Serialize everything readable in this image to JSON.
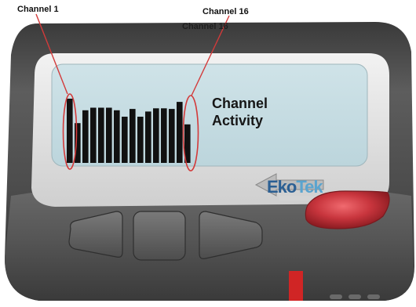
{
  "annotations": {
    "channel_first": "Channel 1",
    "channel_last": "Channel 16",
    "channel_last_ghost": "Channel 16"
  },
  "screen": {
    "caption_line1": "Channel",
    "caption_line2": "Activity",
    "bar_levels": [
      1.0,
      0.62,
      0.82,
      0.86,
      0.86,
      0.86,
      0.82,
      0.72,
      0.84,
      0.72,
      0.8,
      0.85,
      0.85,
      0.84,
      0.95,
      0.6
    ]
  },
  "brand": {
    "part1": "Eko",
    "part2": "Tek"
  },
  "colors": {
    "body": "#4a4a4a",
    "bezel": "#e6e6e6",
    "lcd": "#c7dde3",
    "bars": "#111111",
    "highlight": "#d33a3a",
    "action_button": "#c8353d",
    "led": "#d02525",
    "logo_primary": "#2b5f93",
    "logo_secondary": "#5aa4cf"
  },
  "icons": {
    "left_button": "left-triangle-icon",
    "middle_button": "square-icon",
    "right_button": "right-triangle-icon",
    "action_button": "action-button-icon"
  }
}
